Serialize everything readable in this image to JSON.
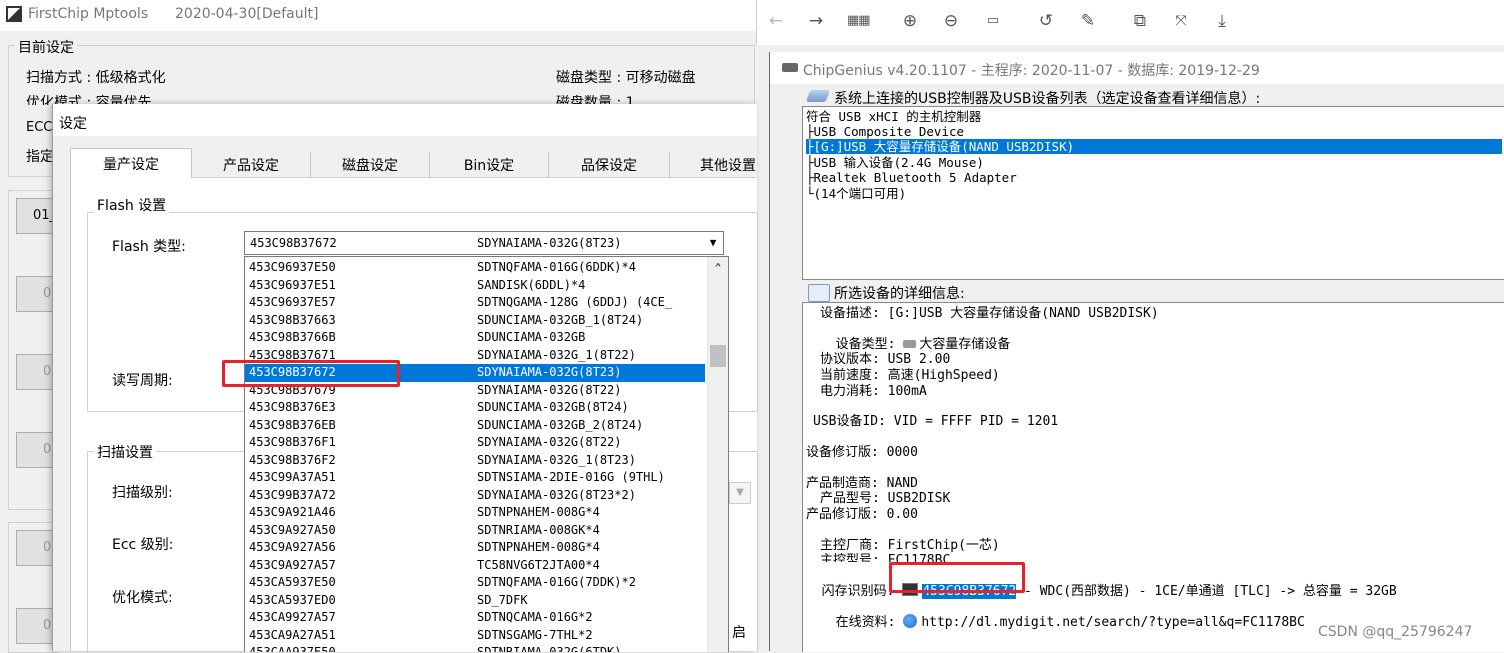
{
  "mptool": {
    "title": "FirstChip Mptools",
    "date": "2020-04-30[Default]",
    "current_settings": {
      "group_title": "目前设定",
      "scan_mode": "扫描方式 : 低级格式化",
      "optimize_mode": "优化模式 : 容量优先",
      "ecc_prefix": "ECC",
      "assign_prefix": "指定",
      "disk_type": "磁盘类型 : 可移动磁盘",
      "disk_count": "磁盘数量 : 1"
    },
    "port_buttons": [
      "01_",
      "02",
      "03",
      "04",
      "05",
      "06"
    ]
  },
  "settings_dialog": {
    "title": "设定",
    "tabs": [
      "量产设定",
      "产品设定",
      "磁盘设定",
      "Bin设定",
      "品保设定",
      "其他设置"
    ],
    "flash_group_title": "Flash 设置",
    "flash_type_label": "Flash 类型:",
    "rw_cycle_label": "读写周期:",
    "flash_combo": {
      "id": "453C98B37672",
      "model": "SDYNAIAMA-032G(8T23)"
    },
    "flash_list": [
      {
        "id": "453C96937E50",
        "model": "SDTNQFAMA-016G(6DDK)*4"
      },
      {
        "id": "453C96937E51",
        "model": "SANDISK(6DDL)*4"
      },
      {
        "id": "453C96937E57",
        "model": "SDTNQGAMA-128G (6DDJ) (4CE_"
      },
      {
        "id": "453C98B37663",
        "model": "SDUNCIAMA-032GB_1(8T24)"
      },
      {
        "id": "453C98B3766B",
        "model": "SDUNCIAMA-032GB"
      },
      {
        "id": "453C98B37671",
        "model": "SDYNAIAMA-032G_1(8T22)"
      },
      {
        "id": "453C98B37672",
        "model": "SDYNAIAMA-032G(8T23)"
      },
      {
        "id": "453C98B37679",
        "model": "SDYNAIAMA-032G(8T22)"
      },
      {
        "id": "453C98B376E3",
        "model": "SDUNCIAMA-032GB(8T24)"
      },
      {
        "id": "453C98B376EB",
        "model": "SDUNCIAMA-032GB_2(8T24)"
      },
      {
        "id": "453C98B376F1",
        "model": "SDYNAIAMA-032G(8T22)"
      },
      {
        "id": "453C98B376F2",
        "model": "SDYNAIAMA-032G_1(8T23)"
      },
      {
        "id": "453C99A37A51",
        "model": "SDTNSIAMA-2DIE-016G (9THL)"
      },
      {
        "id": "453C99B37A72",
        "model": "SDYNAIAMA-032G(8T23*2)"
      },
      {
        "id": "453C9A921A46",
        "model": "SDTNPNAHEM-008G*4"
      },
      {
        "id": "453C9A927A50",
        "model": "SDTNRIAMA-008GK*4"
      },
      {
        "id": "453C9A927A56",
        "model": "SDTNPNAHEM-008G*4"
      },
      {
        "id": "453C9A927A57",
        "model": "TC58NVG6T2JTA00*4"
      },
      {
        "id": "453CA5937E50",
        "model": "SDTNQFAMA-016G(7DDK)*2"
      },
      {
        "id": "453CA5937ED0",
        "model": "SD_7DFK"
      },
      {
        "id": "453CA9927A57",
        "model": "SDTNQCAMA-016G*2"
      },
      {
        "id": "453CA9A27A51",
        "model": "SDTNSGAMG-7THL*2"
      },
      {
        "id": "453CAA937E50",
        "model": "SDTNRIAMA-032G(6TDK)"
      }
    ],
    "selected_index": 6,
    "scan_group_title": "扫描设置",
    "scan_level_label": "扫描级别:",
    "ecc_level_label": "Ecc 级别:",
    "optimize_label": "优化模式:",
    "right_fragment": "启"
  },
  "viewer_toolbar": {
    "icons": [
      "back-icon",
      "forward-icon",
      "grid-icon",
      "zoom-in-icon",
      "zoom-out-icon",
      "actual-size-icon",
      "rotate-icon",
      "edit-icon",
      "crop-icon",
      "fullscreen-icon",
      "download-icon"
    ]
  },
  "chipgenius": {
    "title": "ChipGenius v4.20.1107 - 主程序: 2020-11-07 - 数据库: 2019-12-29",
    "devices_header": "系统上连接的USB控制器及USB设备列表（选定设备查看详细信息）:",
    "tree": [
      "符合 USB xHCI 的主机控制器",
      "├USB Composite Device",
      "├[G:]USB 大容量存储设备(NAND USB2DISK)",
      "├USB 输入设备(2.4G Mouse)",
      "├Realtek Bluetooth 5 Adapter",
      "└(14个端口可用)"
    ],
    "tree_selected_index": 2,
    "details_header": "所选设备的详细信息:",
    "details": {
      "desc": "设备描述: [G:]USB 大容量存储设备(NAND USB2DISK)",
      "type": "设备类型: ",
      "type_value": "大容量存储设备",
      "protocol": "协议版本: USB 2.00",
      "speed": "当前速度: 高速(HighSpeed)",
      "power": "电力消耗: 100mA",
      "ids": "USB设备ID: VID = FFFF PID = 1201",
      "revision": "设备修订版: 0000",
      "vendor": "产品制造商: NAND",
      "model": "产品型号: USB2DISK",
      "product_rev": "产品修订版: 0.00",
      "ctrl_vendor": "主控厂商: FirstChip(一芯)",
      "ctrl_model": "主控型号: FC1178BC",
      "flash_label": "闪存识别码: ",
      "flash_id": "453C98B37672",
      "flash_info": " - WDC(西部数据) - 1CE/单通道 [TLC] -> 总容量 = 32GB",
      "online_label": "在线资料: ",
      "online_url": "http://dl.mydigit.net/search/?type=all&q=FC1178BC"
    }
  },
  "watermark": "CSDN @qq_25796247",
  "colors": {
    "selection": "#0078d7",
    "highlight_box": "#e8212a"
  }
}
